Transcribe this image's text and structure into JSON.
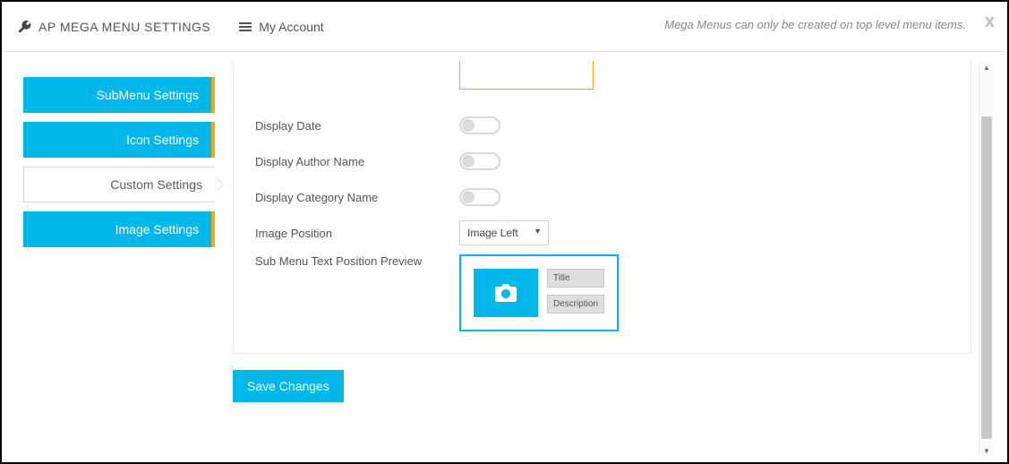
{
  "header": {
    "title": "AP MEGA MENU SETTINGS",
    "account": "My Account",
    "hint": "Mega Menus can only be created on top level menu items.",
    "close": "x"
  },
  "sidebar": {
    "tabs": [
      {
        "label": "SubMenu Settings",
        "active": false
      },
      {
        "label": "Icon Settings",
        "active": false
      },
      {
        "label": "Custom Settings",
        "active": true
      },
      {
        "label": "Image Settings",
        "active": false
      }
    ]
  },
  "form": {
    "display_date_label": "Display Date",
    "display_author_label": "Display Author Name",
    "display_category_label": "Display Category Name",
    "image_position_label": "Image Position",
    "image_position_value": "Image Left",
    "preview_label": "Sub Menu Text Position Preview",
    "preview_title": "Title",
    "preview_description": "Description"
  },
  "actions": {
    "save": "Save Changes"
  },
  "toggles": {
    "display_date": false,
    "display_author": false,
    "display_category": false
  }
}
